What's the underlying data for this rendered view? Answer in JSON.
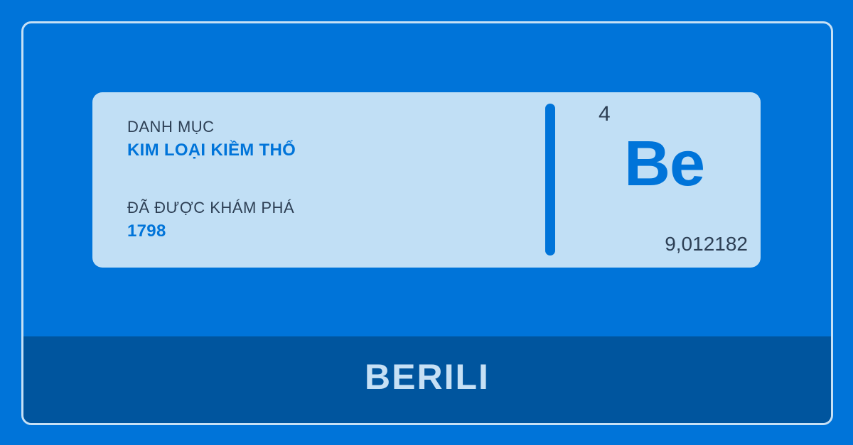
{
  "card": {
    "category_label": "DANH MỤC",
    "category_value": "KIM LOẠI KIỀM THỔ",
    "discovered_label": "ĐÃ ĐƯỢC KHÁM PHÁ",
    "discovered_value": "1798",
    "atomic_number": "4",
    "symbol": "Be",
    "atomic_mass": "9,012182"
  },
  "footer": {
    "element_name": "BERILI"
  },
  "colors": {
    "background": "#0074d9",
    "card": "#c1dff5",
    "footer": "#00559e",
    "accent": "#0074d9",
    "text_dark": "#2d3f54",
    "frame_border": "#c6e0f5"
  }
}
